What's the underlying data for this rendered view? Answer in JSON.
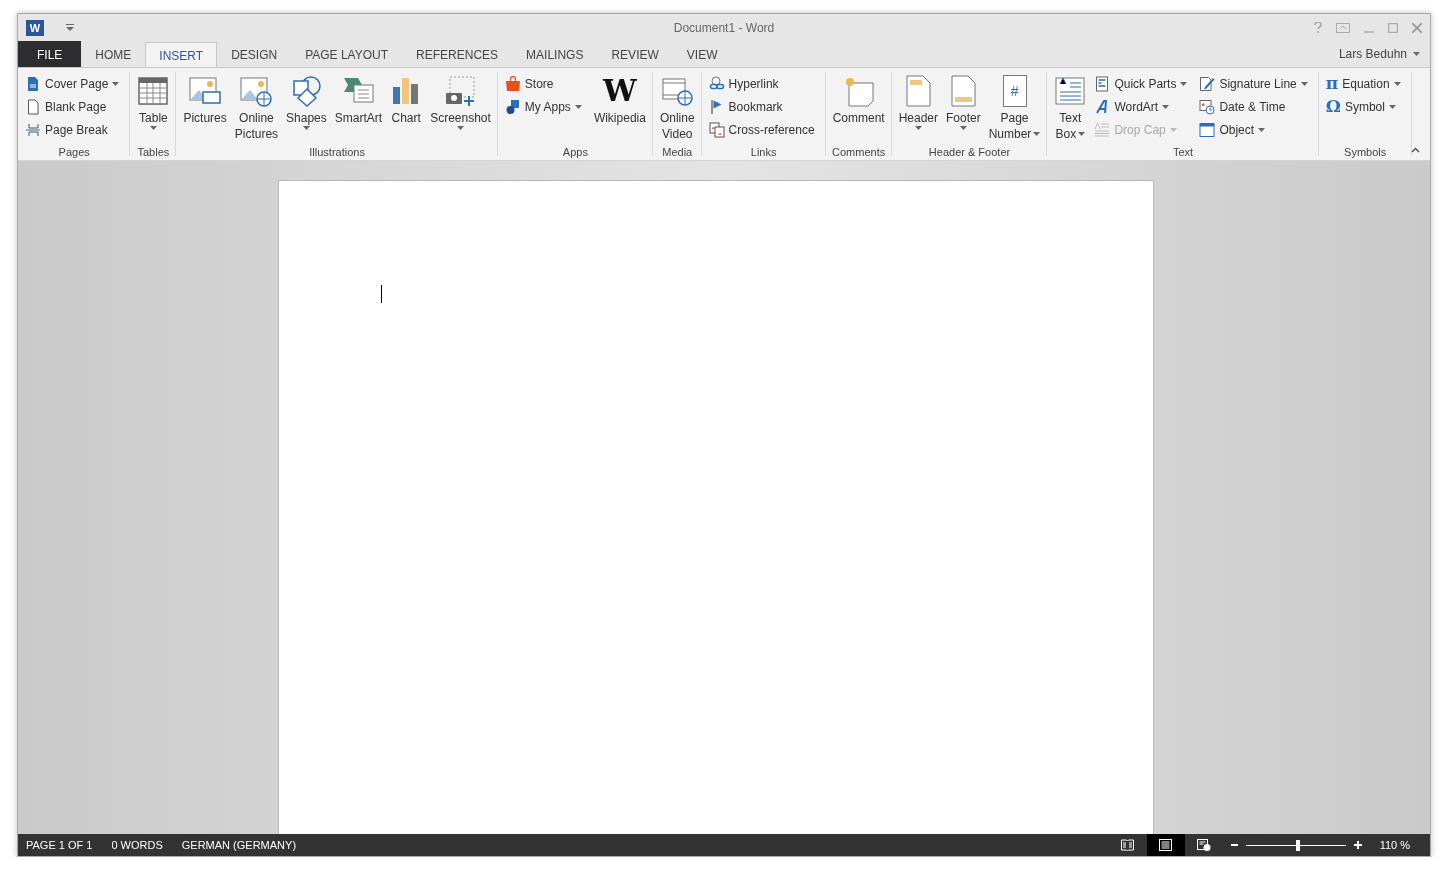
{
  "window": {
    "logo_glyph": "W",
    "title": "Document1 - Word",
    "user": "Lars Beduhn"
  },
  "tabs": [
    {
      "label": "FILE",
      "kind": "file",
      "selected": false
    },
    {
      "label": "HOME",
      "kind": "tab",
      "selected": false
    },
    {
      "label": "INSERT",
      "kind": "tab",
      "selected": true
    },
    {
      "label": "DESIGN",
      "kind": "tab",
      "selected": false
    },
    {
      "label": "PAGE LAYOUT",
      "kind": "tab",
      "selected": false
    },
    {
      "label": "REFERENCES",
      "kind": "tab",
      "selected": false
    },
    {
      "label": "MAILINGS",
      "kind": "tab",
      "selected": false
    },
    {
      "label": "REVIEW",
      "kind": "tab",
      "selected": false
    },
    {
      "label": "VIEW",
      "kind": "tab",
      "selected": false
    }
  ],
  "ribbon": {
    "groups": [
      {
        "label": "Pages",
        "columns": [
          {
            "kind": "stack",
            "items": [
              {
                "label": "Cover Page",
                "dropdown": true,
                "disabled": false
              },
              {
                "label": "Blank Page",
                "dropdown": false,
                "disabled": false
              },
              {
                "label": "Page Break",
                "dropdown": false,
                "disabled": false
              }
            ]
          }
        ]
      },
      {
        "label": "Tables",
        "columns": [
          {
            "kind": "large",
            "lines": [
              "Table"
            ],
            "dropdown": true
          }
        ]
      },
      {
        "label": "Illustrations",
        "columns": [
          {
            "kind": "large",
            "lines": [
              "Pictures"
            ],
            "dropdown": false
          },
          {
            "kind": "large",
            "lines": [
              "Online",
              "Pictures"
            ],
            "dropdown": false
          },
          {
            "kind": "large",
            "lines": [
              "Shapes"
            ],
            "dropdown": true
          },
          {
            "kind": "large",
            "lines": [
              "SmartArt"
            ],
            "dropdown": false
          },
          {
            "kind": "large",
            "lines": [
              "Chart"
            ],
            "dropdown": false
          },
          {
            "kind": "large",
            "lines": [
              "Screenshot"
            ],
            "dropdown": true
          }
        ]
      },
      {
        "label": "Apps",
        "columns": [
          {
            "kind": "stack",
            "items": [
              {
                "label": "Store",
                "dropdown": false,
                "disabled": false
              },
              {
                "label": "My Apps",
                "dropdown": true,
                "disabled": false
              }
            ]
          },
          {
            "kind": "large",
            "lines": [
              "Wikipedia"
            ],
            "dropdown": false,
            "glyph": "W"
          }
        ]
      },
      {
        "label": "Media",
        "columns": [
          {
            "kind": "large",
            "lines": [
              "Online",
              "Video"
            ],
            "dropdown": false
          }
        ]
      },
      {
        "label": "Links",
        "columns": [
          {
            "kind": "stack",
            "items": [
              {
                "label": "Hyperlink",
                "dropdown": false,
                "disabled": false
              },
              {
                "label": "Bookmark",
                "dropdown": false,
                "disabled": false
              },
              {
                "label": "Cross-reference",
                "dropdown": false,
                "disabled": false
              }
            ]
          }
        ]
      },
      {
        "label": "Comments",
        "columns": [
          {
            "kind": "large",
            "lines": [
              "Comment"
            ],
            "dropdown": false
          }
        ]
      },
      {
        "label": "Header & Footer",
        "columns": [
          {
            "kind": "large",
            "lines": [
              "Header"
            ],
            "dropdown": true
          },
          {
            "kind": "large",
            "lines": [
              "Footer"
            ],
            "dropdown": true
          },
          {
            "kind": "large",
            "lines": [
              "Page",
              "Number"
            ],
            "dropdown": true,
            "glyph": "#"
          }
        ]
      },
      {
        "label": "Text",
        "columns": [
          {
            "kind": "large",
            "lines": [
              "Text",
              "Box"
            ],
            "dropdown": true
          },
          {
            "kind": "stack",
            "items": [
              {
                "label": "Quick Parts",
                "dropdown": true,
                "disabled": false
              },
              {
                "label": "WordArt",
                "dropdown": true,
                "disabled": false
              },
              {
                "label": "Drop Cap",
                "dropdown": true,
                "disabled": true
              }
            ]
          },
          {
            "kind": "stack",
            "items": [
              {
                "label": "Signature Line",
                "dropdown": true,
                "disabled": false
              },
              {
                "label": "Date & Time",
                "dropdown": false,
                "disabled": false
              },
              {
                "label": "Object",
                "dropdown": true,
                "disabled": false
              }
            ]
          }
        ]
      },
      {
        "label": "Symbols",
        "columns": [
          {
            "kind": "stack",
            "items": [
              {
                "label": "Equation",
                "dropdown": true,
                "disabled": false,
                "glyph": "π"
              },
              {
                "label": "Symbol",
                "dropdown": true,
                "disabled": false,
                "glyph": "Ω"
              }
            ]
          }
        ]
      }
    ]
  },
  "status_bar": {
    "items": [
      "PAGE 1 OF 1",
      "0 WORDS",
      "GERMAN (GERMANY)"
    ],
    "views": [
      {
        "kind": "read",
        "selected": false
      },
      {
        "kind": "print",
        "selected": true
      },
      {
        "kind": "web",
        "selected": false
      }
    ],
    "zoom": {
      "level": 0.52,
      "reading": "110 %"
    }
  }
}
